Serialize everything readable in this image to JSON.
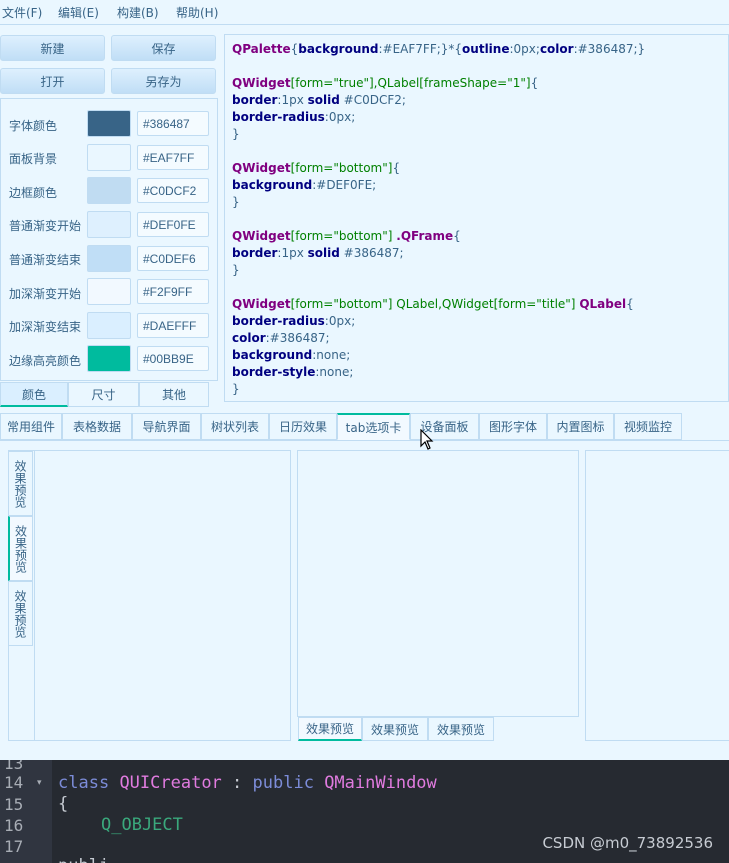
{
  "menubar": {
    "items": [
      "文件(F)",
      "编辑(E)",
      "构建(B)",
      "帮助(H)"
    ]
  },
  "toolbar": {
    "new_label": "新建",
    "save_label": "保存",
    "open_label": "打开",
    "save_as_label": "另存为"
  },
  "colors": [
    {
      "label": "字体颜色",
      "hex": "#386487"
    },
    {
      "label": "面板背景",
      "hex": "#EAF7FF"
    },
    {
      "label": "边框颜色",
      "hex": "#C0DCF2"
    },
    {
      "label": "普通渐变开始",
      "hex": "#DEF0FE"
    },
    {
      "label": "普通渐变结束",
      "hex": "#C0DEF6"
    },
    {
      "label": "加深渐变开始",
      "hex": "#F2F9FF"
    },
    {
      "label": "加深渐变结束",
      "hex": "#DAEFFF"
    },
    {
      "label": "边缘高亮颜色",
      "hex": "#00BB9E"
    }
  ],
  "left_tabs": [
    "颜色",
    "尺寸",
    "其他"
  ],
  "main_tabs": [
    "常用组件",
    "表格数据",
    "导航界面",
    "树状列表",
    "日历效果",
    "tab选项卡",
    "设备面板",
    "图形字体",
    "内置图标",
    "视频监控"
  ],
  "preview": {
    "vtab_label_1": "效果预览",
    "vtab_label_2": "效果预览",
    "vtab_label_3": "效果预览",
    "btab_label_1": "效果预览",
    "btab_label_2": "效果预览",
    "btab_label_3": "效果预览"
  },
  "code_editor": {
    "line_numbers": [
      "13",
      "14",
      "15",
      "16",
      "17"
    ],
    "line14": {
      "kw1": "class",
      "cls1": "QUICreator",
      "colon": " : ",
      "kw2": "public",
      "cls2": "QMainWindow"
    },
    "line15": "{",
    "line16": "Q_OBJECT",
    "line18_partial": "publi"
  },
  "watermark": "CSDN @m0_73892536"
}
